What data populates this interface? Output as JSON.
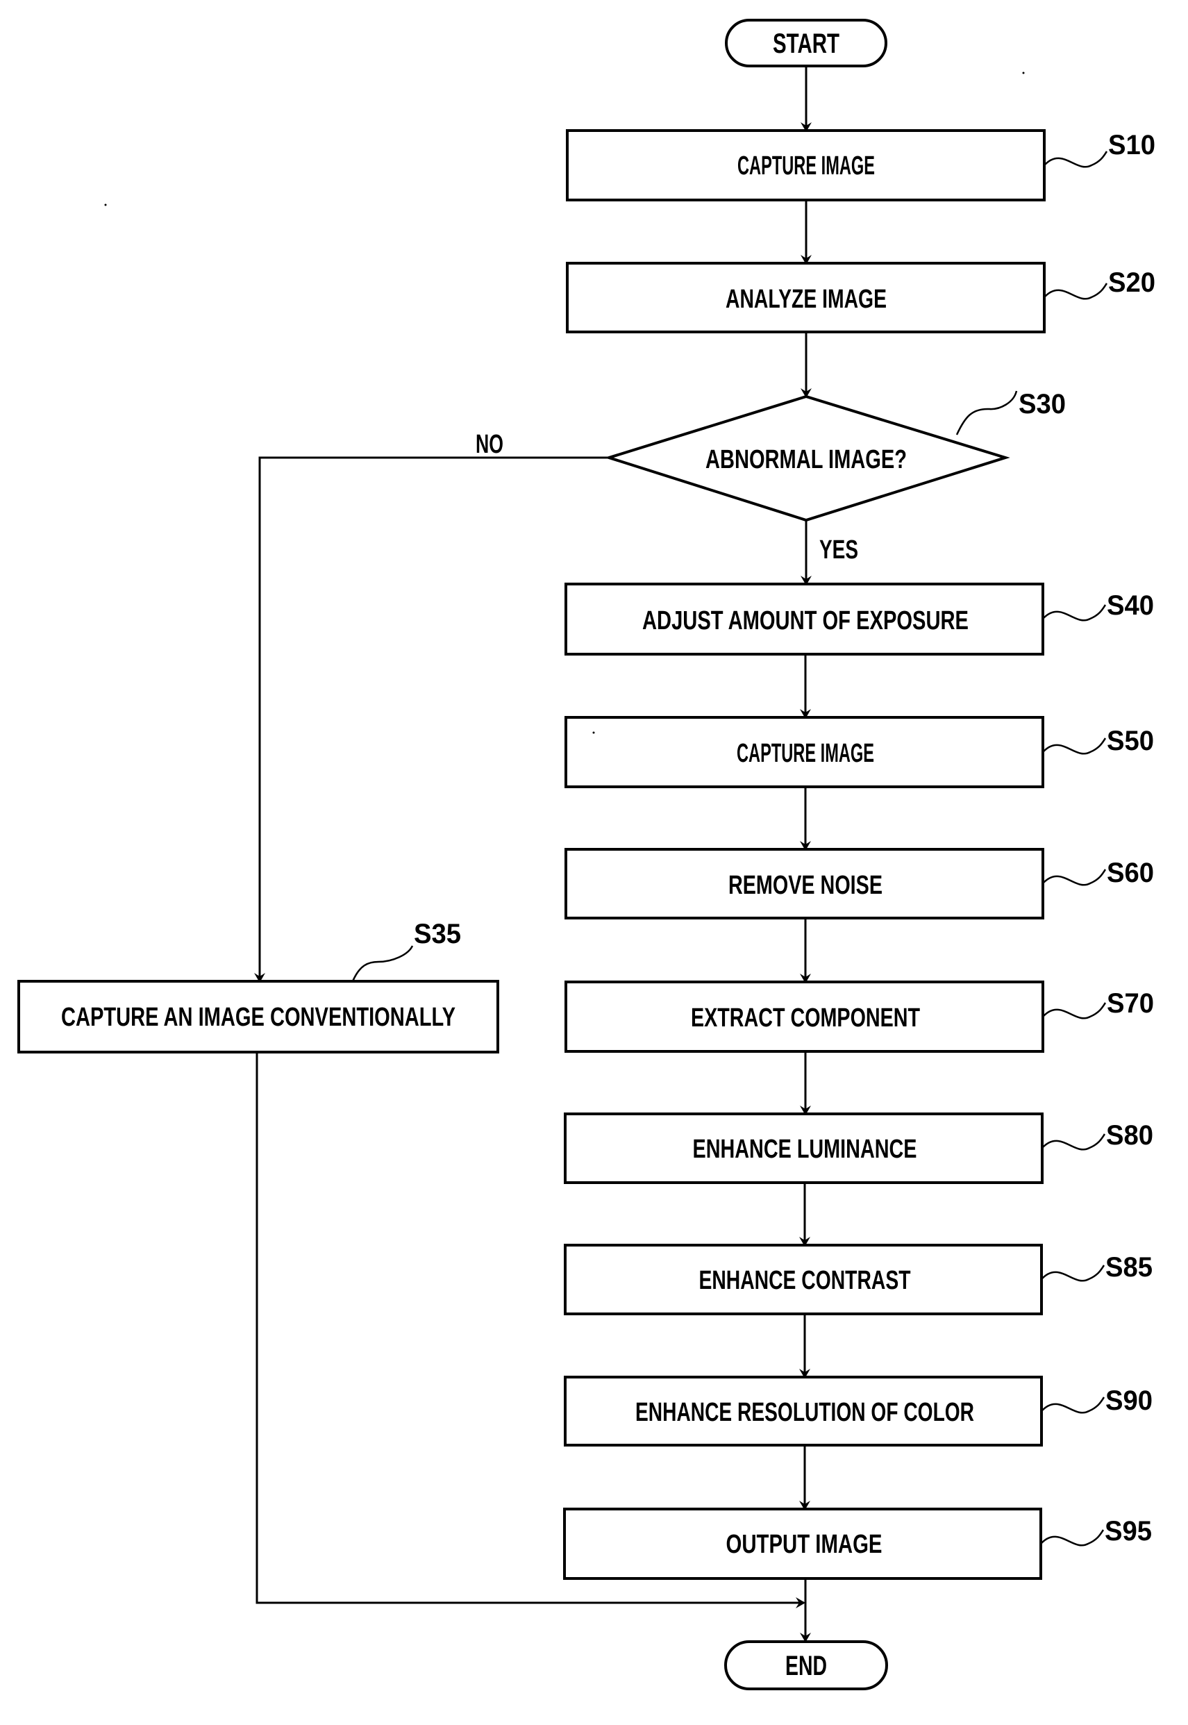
{
  "flowchart": {
    "start": "START",
    "end": "END",
    "steps": [
      {
        "id": "S10",
        "text": "CAPTURE IMAGE"
      },
      {
        "id": "S20",
        "text": "ANALYZE IMAGE"
      },
      {
        "id": "S30",
        "text": "ABNORMAL IMAGE?"
      },
      {
        "id": "S40",
        "text": "ADJUST AMOUNT OF EXPOSURE"
      },
      {
        "id": "S50",
        "text": "CAPTURE IMAGE"
      },
      {
        "id": "S60",
        "text": "REMOVE NOISE"
      },
      {
        "id": "S70",
        "text": "EXTRACT COMPONENT"
      },
      {
        "id": "S80",
        "text": "ENHANCE LUMINANCE"
      },
      {
        "id": "S85",
        "text": "ENHANCE CONTRAST"
      },
      {
        "id": "S90",
        "text": "ENHANCE RESOLUTION OF COLOR"
      },
      {
        "id": "S95",
        "text": "OUTPUT IMAGE"
      },
      {
        "id": "S35",
        "text": "CAPTURE AN IMAGE CONVENTIONALLY"
      }
    ],
    "branch_yes": "YES",
    "branch_no": "NO"
  }
}
